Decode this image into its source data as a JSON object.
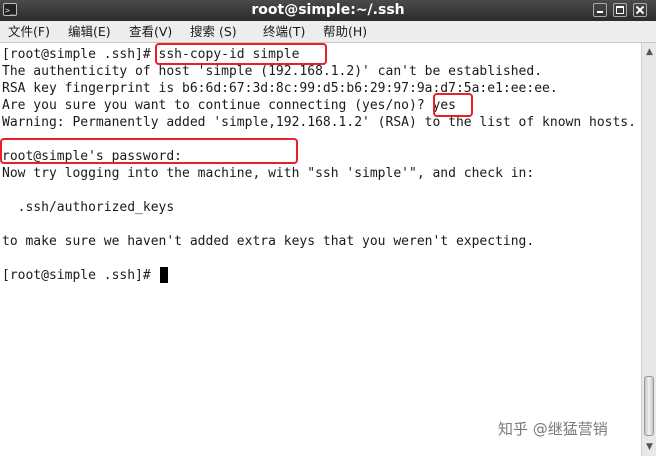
{
  "window": {
    "title": "root@simple:~/.ssh",
    "icon_text": ">_"
  },
  "menu": [
    "文件(F)",
    "编辑(E)",
    "查看(V)",
    "搜索 (S)",
    "终端(T)",
    "帮助(H)"
  ],
  "terminal": {
    "lines": [
      "[root@simple .ssh]# ssh-copy-id simple",
      "The authenticity of host 'simple (192.168.1.2)' can't be established.",
      "RSA key fingerprint is b6:6d:67:3d:8c:99:d5:b6:29:97:9a:d7:5a:e1:ee:ee.",
      "Are you sure you want to continue connecting (yes/no)? yes",
      "Warning: Permanently added 'simple,192.168.1.2' (RSA) to the list of known hosts.",
      "",
      "root@simple's password:",
      "Now try logging into the machine, with \"ssh 'simple'\", and check in:",
      "",
      "  .ssh/authorized_keys",
      "",
      "to make sure we haven't added extra keys that you weren't expecting.",
      "",
      "[root@simple .ssh]# "
    ]
  },
  "watermark": "知乎 @继猛营销",
  "colors": {
    "highlight": "#e8202a",
    "titlebar": "#3a3a3a"
  }
}
